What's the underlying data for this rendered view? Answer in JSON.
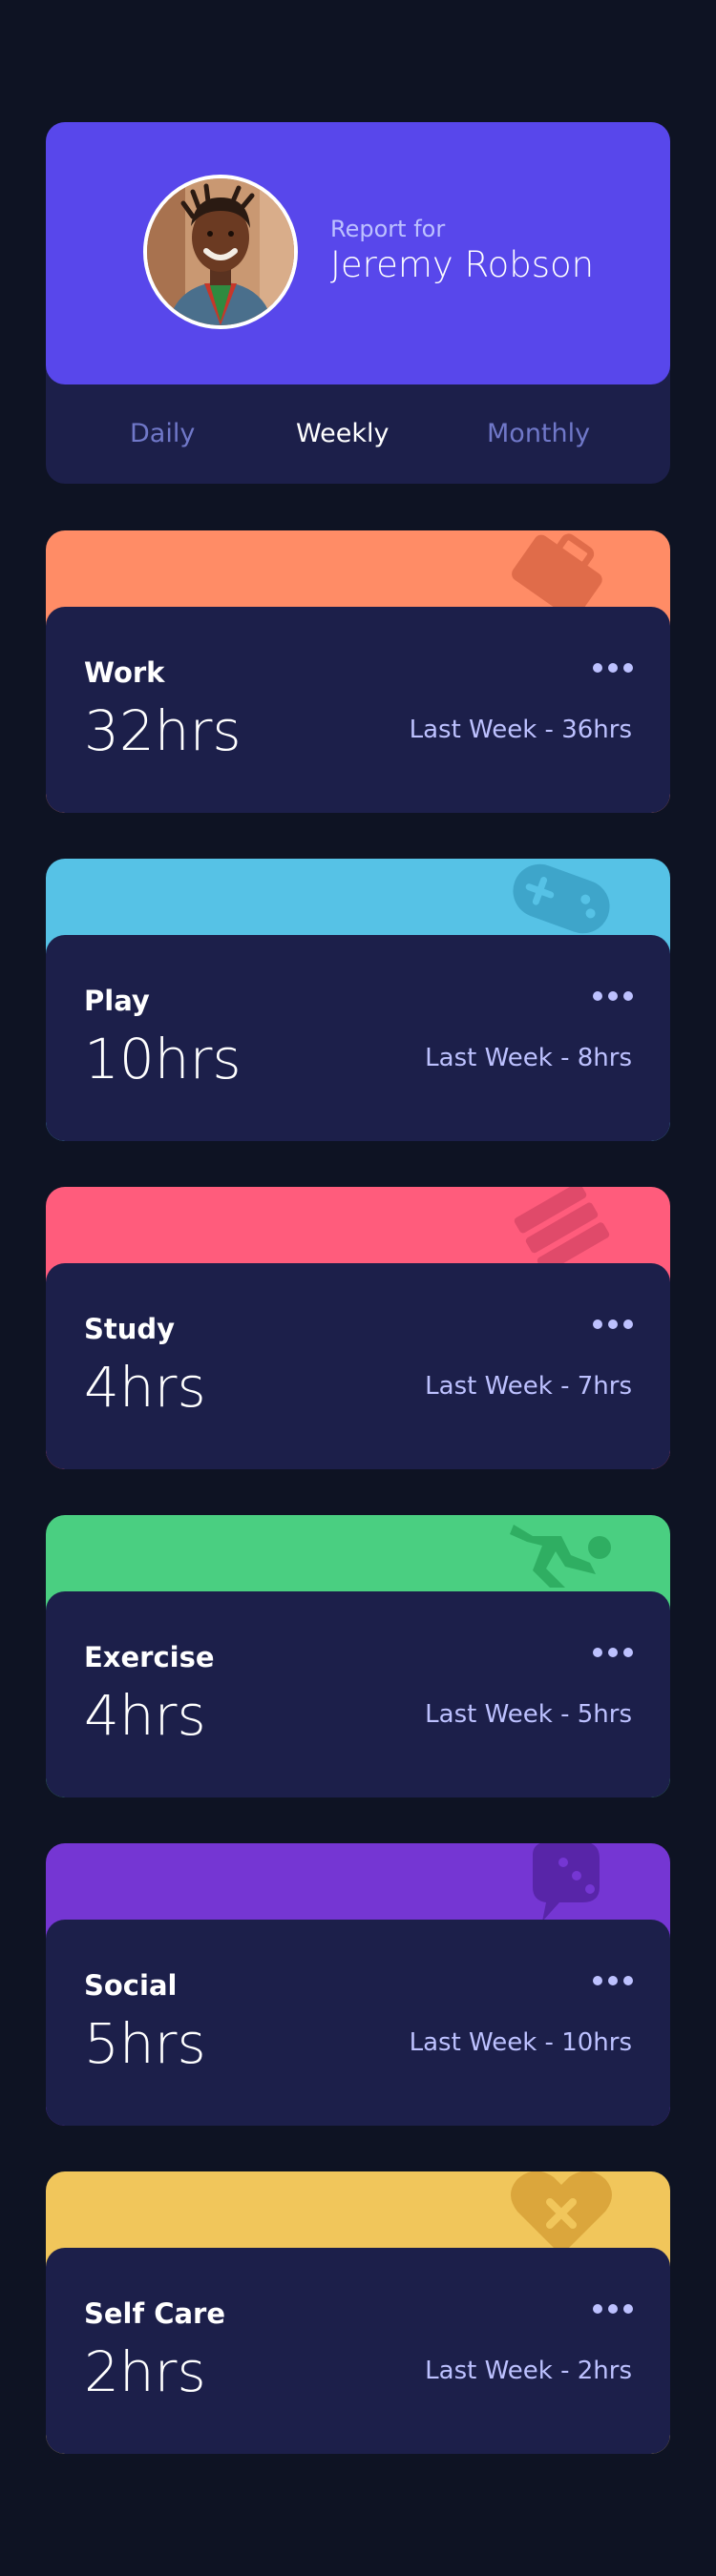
{
  "profile": {
    "report_label": "Report for",
    "name": "Jeremy Robson"
  },
  "tabs": [
    {
      "label": "Daily",
      "active": false
    },
    {
      "label": "Weekly",
      "active": true
    },
    {
      "label": "Monthly",
      "active": false
    }
  ],
  "activities": [
    {
      "title": "Work",
      "hours": "32hrs",
      "last_week": "Last Week - 36hrs",
      "color": "#ff8c66",
      "icon": "briefcase-icon"
    },
    {
      "title": "Play",
      "hours": "10hrs",
      "last_week": "Last Week - 8hrs",
      "color": "#56c2e6",
      "icon": "gamepad-icon"
    },
    {
      "title": "Study",
      "hours": "4hrs",
      "last_week": "Last Week - 7hrs",
      "color": "#ff5c7c",
      "icon": "books-icon"
    },
    {
      "title": "Exercise",
      "hours": "4hrs",
      "last_week": "Last Week - 5hrs",
      "color": "#4acf81",
      "icon": "runner-icon"
    },
    {
      "title": "Social",
      "hours": "5hrs",
      "last_week": "Last Week - 10hrs",
      "color": "#7536d3",
      "icon": "chat-icon"
    },
    {
      "title": "Self Care",
      "hours": "2hrs",
      "last_week": "Last Week - 2hrs",
      "color": "#f1c65b",
      "icon": "heart-icon"
    }
  ],
  "colors": {
    "background": "#0e1323",
    "card": "#1c1f4a",
    "profile": "#5847eb",
    "muted_text": "#7078c9",
    "pale_text": "#bdc1ff"
  }
}
